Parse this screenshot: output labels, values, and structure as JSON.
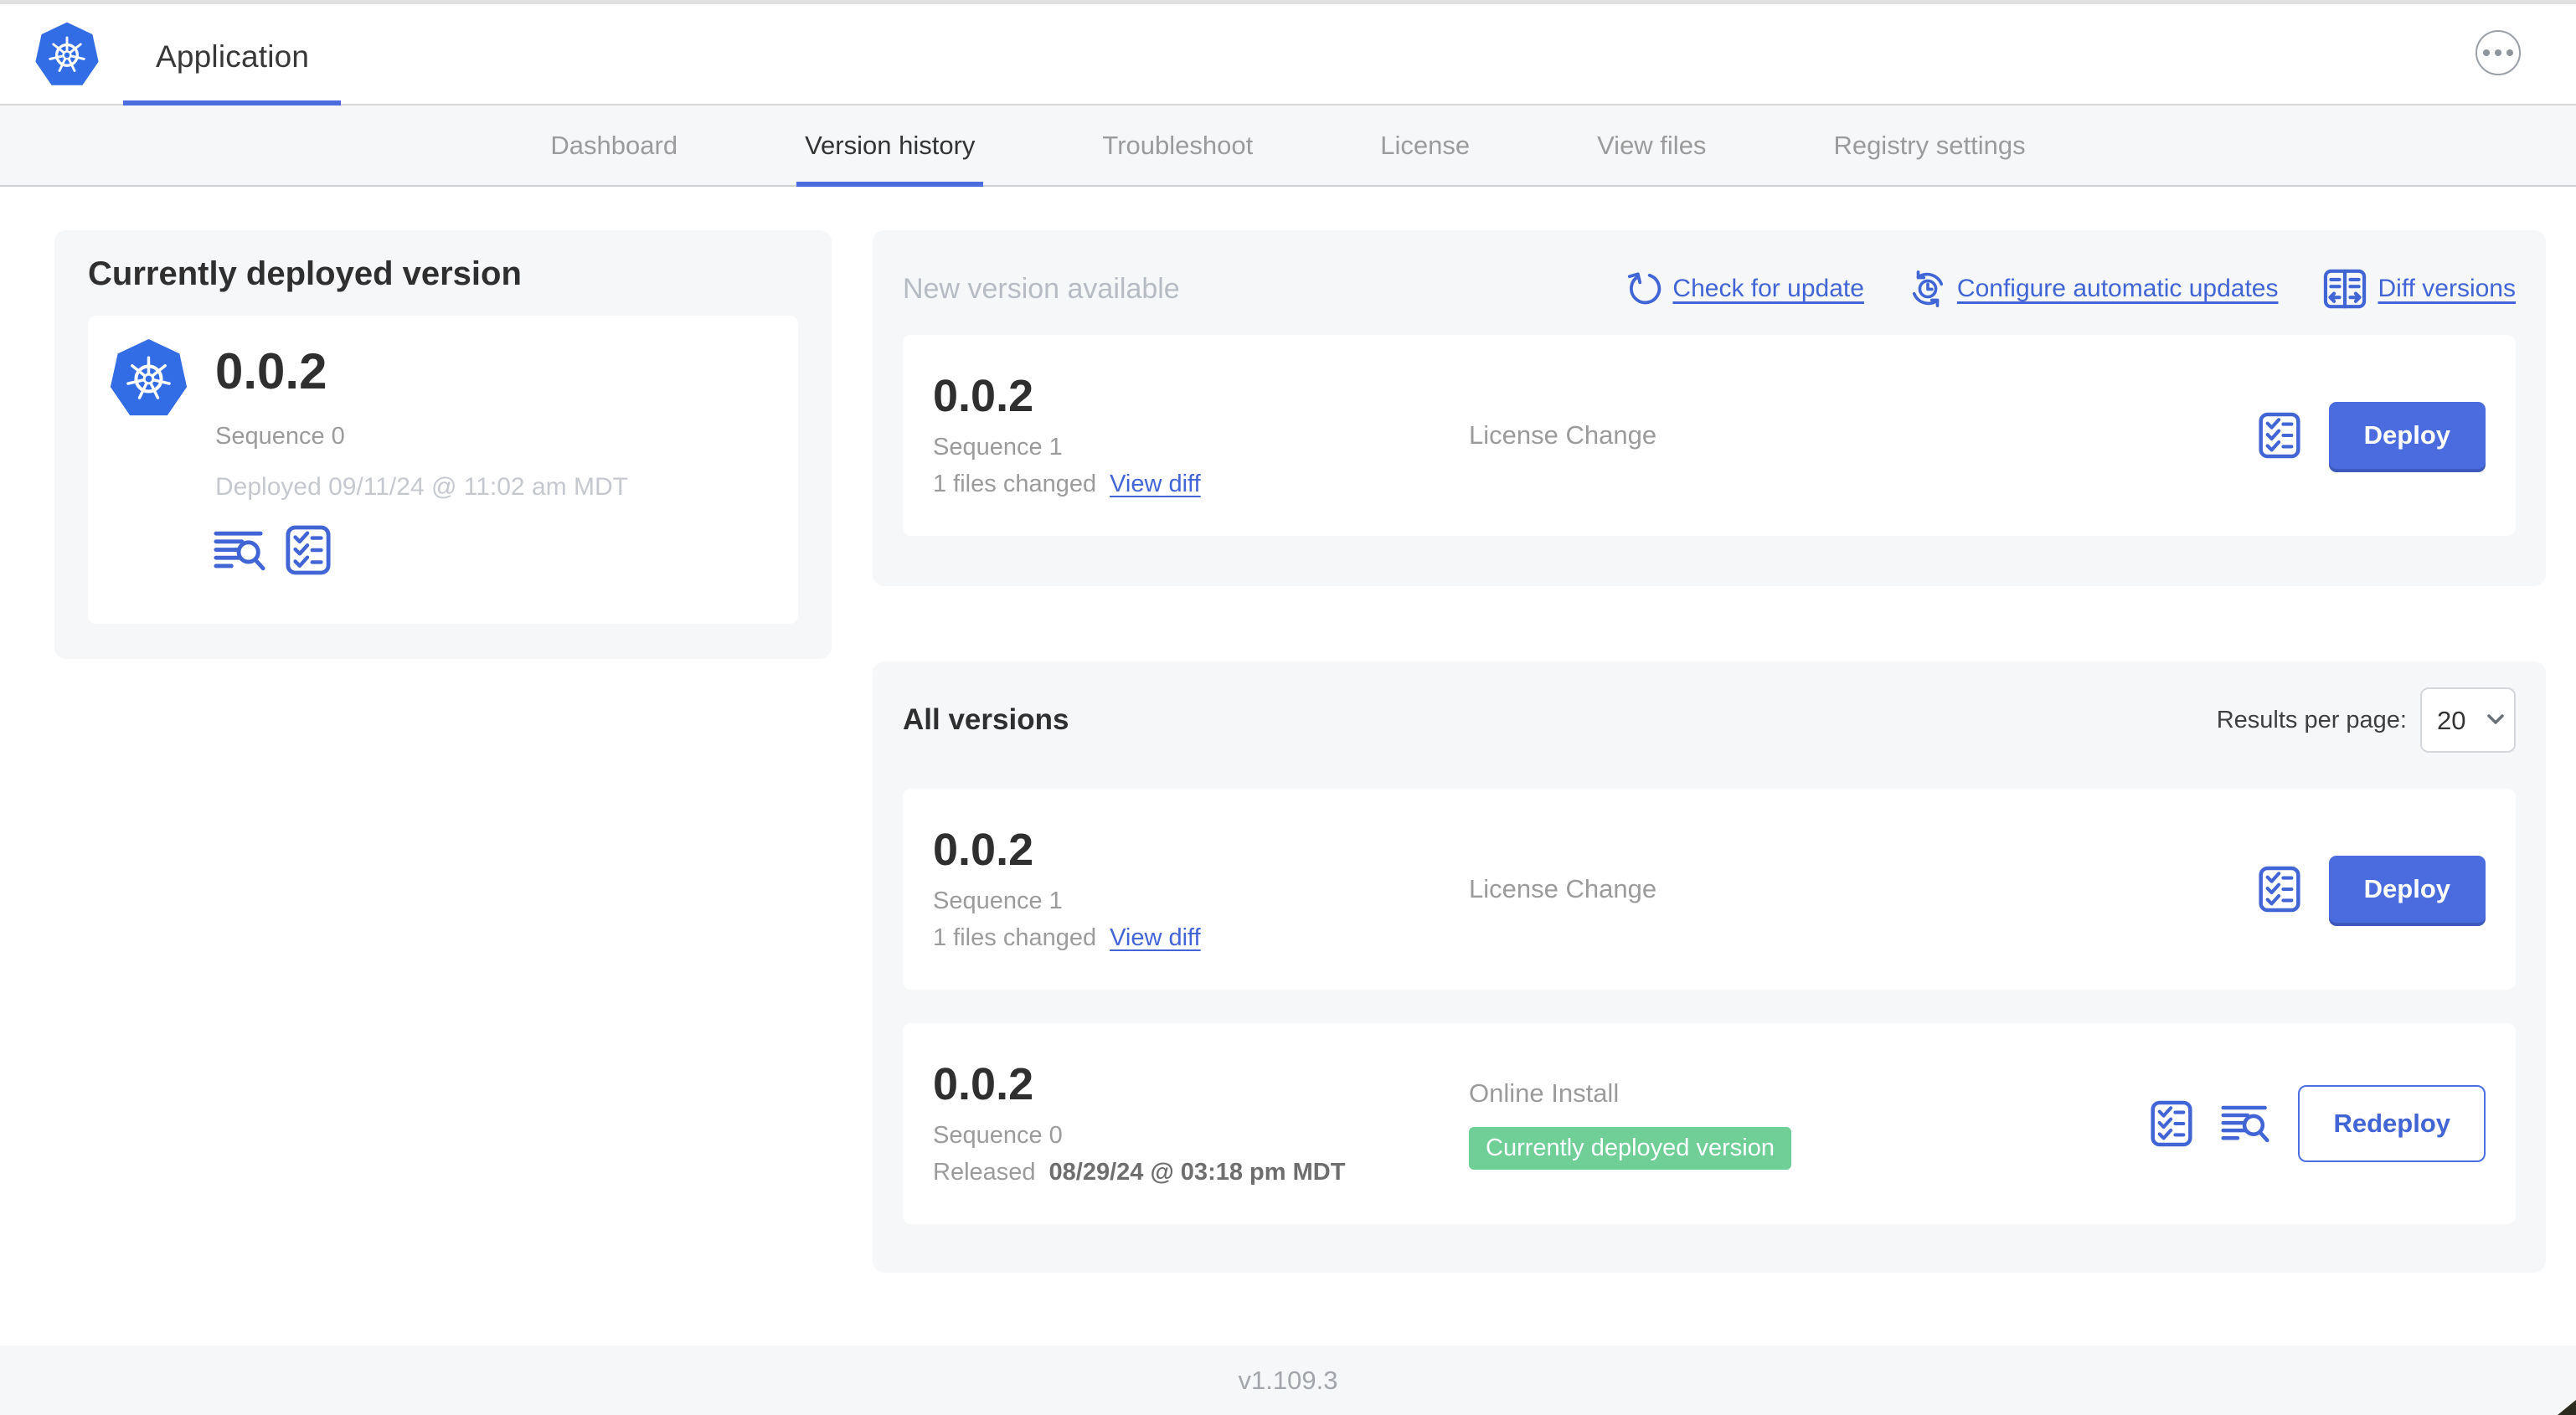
{
  "colors": {
    "accent": "#4A6CDE",
    "link": "#4265D6",
    "k8s_blue": "#326DE6",
    "badge_green": "#6FCF97",
    "panel_bg": "#f5f7f9"
  },
  "icons": {
    "app_logo": "kubernetes-logo",
    "more": "ellipsis-circle-icon",
    "check_update": "refresh-icon",
    "auto_update": "clock-sync-icon",
    "diff": "diff-columns-icon",
    "logs": "log-search-icon",
    "preflight": "checklist-icon",
    "select_chevron": "chevron-down-icon"
  },
  "header": {
    "title": "Application"
  },
  "nav": {
    "tabs": [
      {
        "label": "Dashboard",
        "active": false
      },
      {
        "label": "Version history",
        "active": true
      },
      {
        "label": "Troubleshoot",
        "active": false
      },
      {
        "label": "License",
        "active": false
      },
      {
        "label": "View files",
        "active": false
      },
      {
        "label": "Registry settings",
        "active": false
      }
    ]
  },
  "deployed": {
    "title": "Currently deployed version",
    "version": "0.0.2",
    "sequence": "Sequence 0",
    "deployed_at": "Deployed 09/11/24 @ 11:02 am MDT"
  },
  "updates": {
    "title": "New version available",
    "actions": [
      {
        "label": "Check for update"
      },
      {
        "label": "Configure automatic updates"
      },
      {
        "label": "Diff versions"
      }
    ],
    "card": {
      "version": "0.0.2",
      "sequence": "Sequence 1",
      "files_changed": "1 files changed",
      "view_diff_label": "View diff",
      "source": "License Change",
      "deploy_label": "Deploy"
    }
  },
  "versions": {
    "title": "All versions",
    "results_per_page_label": "Results per page:",
    "per_page": "20",
    "rows": [
      {
        "version": "0.0.2",
        "sequence": "Sequence 1",
        "files_changed": "1 files changed",
        "view_diff_label": "View diff",
        "source": "License Change",
        "action_label": "Deploy"
      },
      {
        "version": "0.0.2",
        "sequence": "Sequence 0",
        "released_prefix": "Released",
        "released_date": "08/29/24 @ 03:18 pm MDT",
        "source": "Online Install",
        "badge": "Currently deployed version",
        "action_label": "Redeploy"
      }
    ]
  },
  "footer": {
    "app_version": "v1.109.3"
  }
}
